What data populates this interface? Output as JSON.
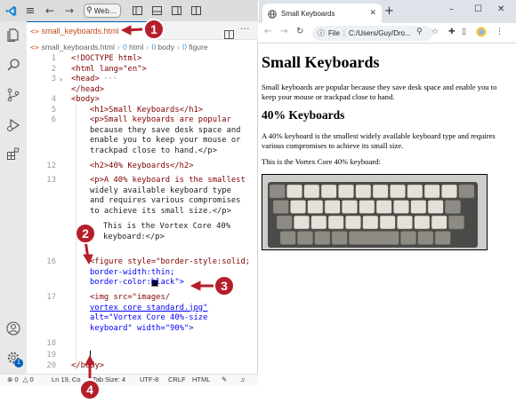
{
  "vscode": {
    "search_label": "Web...",
    "tab_icon": "<>",
    "tab_title": "small_keyboards.html",
    "breadcrumb": {
      "file_icon": "<>",
      "file": "small_keyboards.html",
      "items": [
        "html",
        "body",
        "figure"
      ]
    },
    "lines": [
      {
        "num": "1",
        "code": "<!DOCTYPE html>"
      },
      {
        "num": "2",
        "code": "<html lang=\"en\">"
      },
      {
        "num": "3",
        "code": "<head>"
      },
      {
        "num": "",
        "code": "</head>"
      },
      {
        "num": "4",
        "code": "<body>"
      },
      {
        "num": "5",
        "code": "<h1>Small Keyboards</h1>"
      },
      {
        "num": "6",
        "code": "<p>Small keyboards are popular"
      },
      {
        "num": "",
        "code": "because they save desk space and"
      },
      {
        "num": "",
        "code": "enable you to keep your mouse or"
      },
      {
        "num": "",
        "code": "trackpad close to hand.</p>"
      },
      {
        "num": "12",
        "code": "<h2>40% Keyboards</h2>"
      },
      {
        "num": "13",
        "code": "<p>A 40% keyboard is the smallest"
      },
      {
        "num": "",
        "code": "widely available keyboard type"
      },
      {
        "num": "",
        "code": "and requires various compromises"
      },
      {
        "num": "",
        "code": "to achieve its small size.</p>"
      },
      {
        "num": "",
        "code": "This is the Vortex Core 40%"
      },
      {
        "num": "",
        "code": "keyboard:</p>"
      },
      {
        "num": "",
        "code": ""
      },
      {
        "num": "16",
        "code": "<figure style=\"border-style:solid;"
      },
      {
        "num": "",
        "code": "border-width:thin;"
      },
      {
        "num": "",
        "code": "border-color:black\">"
      },
      {
        "num": "17",
        "code": "<img src=\"images/"
      },
      {
        "num": "",
        "code": "vortex_core_standard.jpg\""
      },
      {
        "num": "",
        "code": "alt=\"Vortex Core 40%-size"
      },
      {
        "num": "",
        "code": "keyboard\" width=\"90%\">"
      },
      {
        "num": "",
        "code": ""
      },
      {
        "num": "18",
        "code": ""
      },
      {
        "num": "19",
        "code": ""
      },
      {
        "num": "20",
        "code": "</body>"
      }
    ],
    "status": {
      "problems": "0",
      "warnings": "0",
      "position": "Ln 19, Co",
      "tab_size": "Tab Size: 4",
      "encoding": "UTF-8",
      "eol": "CRLF",
      "language": "HTML"
    },
    "badge": "1"
  },
  "browser": {
    "tab_title": "Small Keyboards",
    "omnibox_label": "File",
    "omnibox_path": "C:/Users/Guy/Dro...",
    "page": {
      "h1": "Small Keyboards",
      "p1": "Small keyboards are popular because they save desk space and enable you to keep your mouse or trackpad close to hand.",
      "h2": "40% Keyboards",
      "p2": "A 40% keyboard is the smallest widely available keyboard type and requires various compromises to achieve its small size.",
      "p3": "This is the Vortex Core 40% keyboard:"
    }
  },
  "callouts": [
    "1",
    "2",
    "3",
    "4"
  ],
  "colors": {
    "callout": "#b51e2a",
    "tag": "#800000",
    "attribute": "#e50000",
    "value": "#0000ff",
    "tab_text": "#c24a1e"
  }
}
